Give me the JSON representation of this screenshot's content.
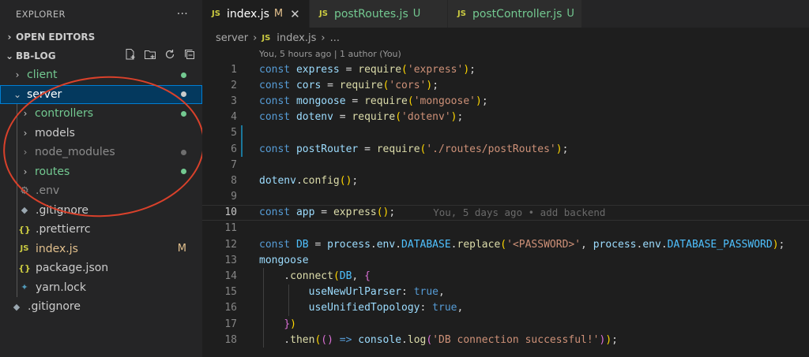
{
  "explorer": {
    "title": "EXPLORER",
    "more": "···",
    "open_editors": "OPEN EDITORS",
    "project": "BB-LOG",
    "tree": [
      {
        "label": "client",
        "kind": "folder",
        "depth": 0,
        "expanded": false,
        "color": "#73c991",
        "badge": "dot"
      },
      {
        "label": "server",
        "kind": "folder",
        "depth": 0,
        "expanded": true,
        "color": "#ffffff",
        "badge": "dot-white",
        "selected": true
      },
      {
        "label": "controllers",
        "kind": "folder",
        "depth": 1,
        "expanded": false,
        "color": "#73c991",
        "badge": "dot"
      },
      {
        "label": "models",
        "kind": "folder",
        "depth": 1,
        "expanded": false,
        "color": "#cccccc",
        "badge": ""
      },
      {
        "label": "node_modules",
        "kind": "folder",
        "depth": 1,
        "expanded": false,
        "color": "#8c8c8c",
        "badge": "dot-grey"
      },
      {
        "label": "routes",
        "kind": "folder",
        "depth": 1,
        "expanded": false,
        "color": "#73c991",
        "badge": "dot"
      },
      {
        "label": ".env",
        "kind": "file",
        "icon": "gear-icon",
        "depth": 1,
        "color": "#8c8c8c"
      },
      {
        "label": ".gitignore",
        "kind": "file",
        "icon": "git-icon",
        "depth": 1,
        "color": "#cccccc"
      },
      {
        "label": ".prettierrc",
        "kind": "file",
        "icon": "braces-icon",
        "depth": 1,
        "color": "#cccccc"
      },
      {
        "label": "index.js",
        "kind": "file",
        "icon": "js-icon",
        "depth": 1,
        "color": "#e2c08d",
        "badge": "M"
      },
      {
        "label": "package.json",
        "kind": "file",
        "icon": "braces-icon",
        "depth": 1,
        "color": "#cccccc"
      },
      {
        "label": "yarn.lock",
        "kind": "file",
        "icon": "yarn-icon",
        "depth": 1,
        "color": "#cccccc"
      },
      {
        "label": ".gitignore",
        "kind": "file",
        "icon": "git-icon",
        "depth": 0,
        "color": "#cccccc"
      }
    ]
  },
  "tabs": [
    {
      "label": "index.js",
      "status": "M",
      "active": true,
      "close": "✕"
    },
    {
      "label": "postRoutes.js",
      "status": "U",
      "active": false
    },
    {
      "label": "postController.js",
      "status": "U",
      "active": false
    }
  ],
  "breadcrumb": {
    "folder": "server",
    "file": "index.js",
    "more": "..."
  },
  "blame_header": "You, 5 hours ago | 1 author (You)",
  "inline_blame": "You, 5 days ago • add backend",
  "code": [
    {
      "n": "1",
      "tokens": [
        [
          "k",
          "const "
        ],
        [
          "v",
          "express"
        ],
        [
          "p",
          " = "
        ],
        [
          "f",
          "require"
        ],
        [
          "b",
          "("
        ],
        [
          "s",
          "'express'"
        ],
        [
          "b",
          ")"
        ],
        [
          "p",
          ";"
        ]
      ]
    },
    {
      "n": "2",
      "tokens": [
        [
          "k",
          "const "
        ],
        [
          "v",
          "cors"
        ],
        [
          "p",
          " = "
        ],
        [
          "f",
          "require"
        ],
        [
          "b",
          "("
        ],
        [
          "s",
          "'cors'"
        ],
        [
          "b",
          ")"
        ],
        [
          "p",
          ";"
        ]
      ]
    },
    {
      "n": "3",
      "tokens": [
        [
          "k",
          "const "
        ],
        [
          "v",
          "mongoose"
        ],
        [
          "p",
          " = "
        ],
        [
          "f",
          "require"
        ],
        [
          "b",
          "("
        ],
        [
          "s",
          "'mongoose'"
        ],
        [
          "b",
          ")"
        ],
        [
          "p",
          ";"
        ]
      ]
    },
    {
      "n": "4",
      "tokens": [
        [
          "k",
          "const "
        ],
        [
          "v",
          "dotenv"
        ],
        [
          "p",
          " = "
        ],
        [
          "f",
          "require"
        ],
        [
          "b",
          "("
        ],
        [
          "s",
          "'dotenv'"
        ],
        [
          "b",
          ")"
        ],
        [
          "p",
          ";"
        ]
      ]
    },
    {
      "n": "5",
      "tokens": []
    },
    {
      "n": "6",
      "tokens": [
        [
          "k",
          "const "
        ],
        [
          "v",
          "postRouter"
        ],
        [
          "p",
          " = "
        ],
        [
          "f",
          "require"
        ],
        [
          "b",
          "("
        ],
        [
          "s",
          "'./routes/postRoutes'"
        ],
        [
          "b",
          ")"
        ],
        [
          "p",
          ";"
        ]
      ]
    },
    {
      "n": "7",
      "tokens": []
    },
    {
      "n": "8",
      "tokens": [
        [
          "v",
          "dotenv"
        ],
        [
          "p",
          "."
        ],
        [
          "f",
          "config"
        ],
        [
          "b",
          "()"
        ],
        [
          "p",
          ";"
        ]
      ]
    },
    {
      "n": "9",
      "tokens": []
    },
    {
      "n": "10",
      "tokens": [
        [
          "k",
          "const "
        ],
        [
          "v",
          "app"
        ],
        [
          "p",
          " = "
        ],
        [
          "f",
          "express"
        ],
        [
          "b",
          "()"
        ],
        [
          "p",
          ";"
        ]
      ],
      "current": true
    },
    {
      "n": "11",
      "tokens": []
    },
    {
      "n": "12",
      "tokens": [
        [
          "k",
          "const "
        ],
        [
          "c",
          "DB"
        ],
        [
          "p",
          " = "
        ],
        [
          "v",
          "process"
        ],
        [
          "p",
          "."
        ],
        [
          "v",
          "env"
        ],
        [
          "p",
          "."
        ],
        [
          "c",
          "DATABASE"
        ],
        [
          "p",
          "."
        ],
        [
          "f",
          "replace"
        ],
        [
          "b",
          "("
        ],
        [
          "s",
          "'<PASSWORD>'"
        ],
        [
          "p",
          ", "
        ],
        [
          "v",
          "process"
        ],
        [
          "p",
          "."
        ],
        [
          "v",
          "env"
        ],
        [
          "p",
          "."
        ],
        [
          "c",
          "DATABASE_PASSWORD"
        ],
        [
          "b",
          ")"
        ],
        [
          "p",
          ";"
        ]
      ]
    },
    {
      "n": "13",
      "tokens": [
        [
          "v",
          "mongoose"
        ]
      ]
    },
    {
      "n": "14",
      "tokens": [
        [
          "p",
          "    ."
        ],
        [
          "f",
          "connect"
        ],
        [
          "b",
          "("
        ],
        [
          "c",
          "DB"
        ],
        [
          "p",
          ", "
        ],
        [
          "b2",
          "{"
        ]
      ]
    },
    {
      "n": "15",
      "tokens": [
        [
          "p",
          "        "
        ],
        [
          "v",
          "useNewUrlParser"
        ],
        [
          "p",
          ": "
        ],
        [
          "k",
          "true"
        ],
        [
          "p",
          ","
        ]
      ]
    },
    {
      "n": "16",
      "tokens": [
        [
          "p",
          "        "
        ],
        [
          "v",
          "useUnifiedTopology"
        ],
        [
          "p",
          ": "
        ],
        [
          "k",
          "true"
        ],
        [
          "p",
          ","
        ]
      ]
    },
    {
      "n": "17",
      "tokens": [
        [
          "p",
          "    "
        ],
        [
          "b2",
          "}"
        ],
        [
          "b",
          ")"
        ]
      ]
    },
    {
      "n": "18",
      "tokens": [
        [
          "p",
          "    ."
        ],
        [
          "f",
          "then"
        ],
        [
          "b",
          "("
        ],
        [
          "b2",
          "()"
        ],
        [
          "p",
          " "
        ],
        [
          "k",
          "=>"
        ],
        [
          "p",
          " "
        ],
        [
          "v",
          "console"
        ],
        [
          "p",
          "."
        ],
        [
          "f",
          "log"
        ],
        [
          "b2",
          "("
        ],
        [
          "s",
          "'DB connection successful!'"
        ],
        [
          "b2",
          ")"
        ],
        [
          "b",
          ")"
        ],
        [
          "p",
          ";"
        ]
      ]
    }
  ]
}
